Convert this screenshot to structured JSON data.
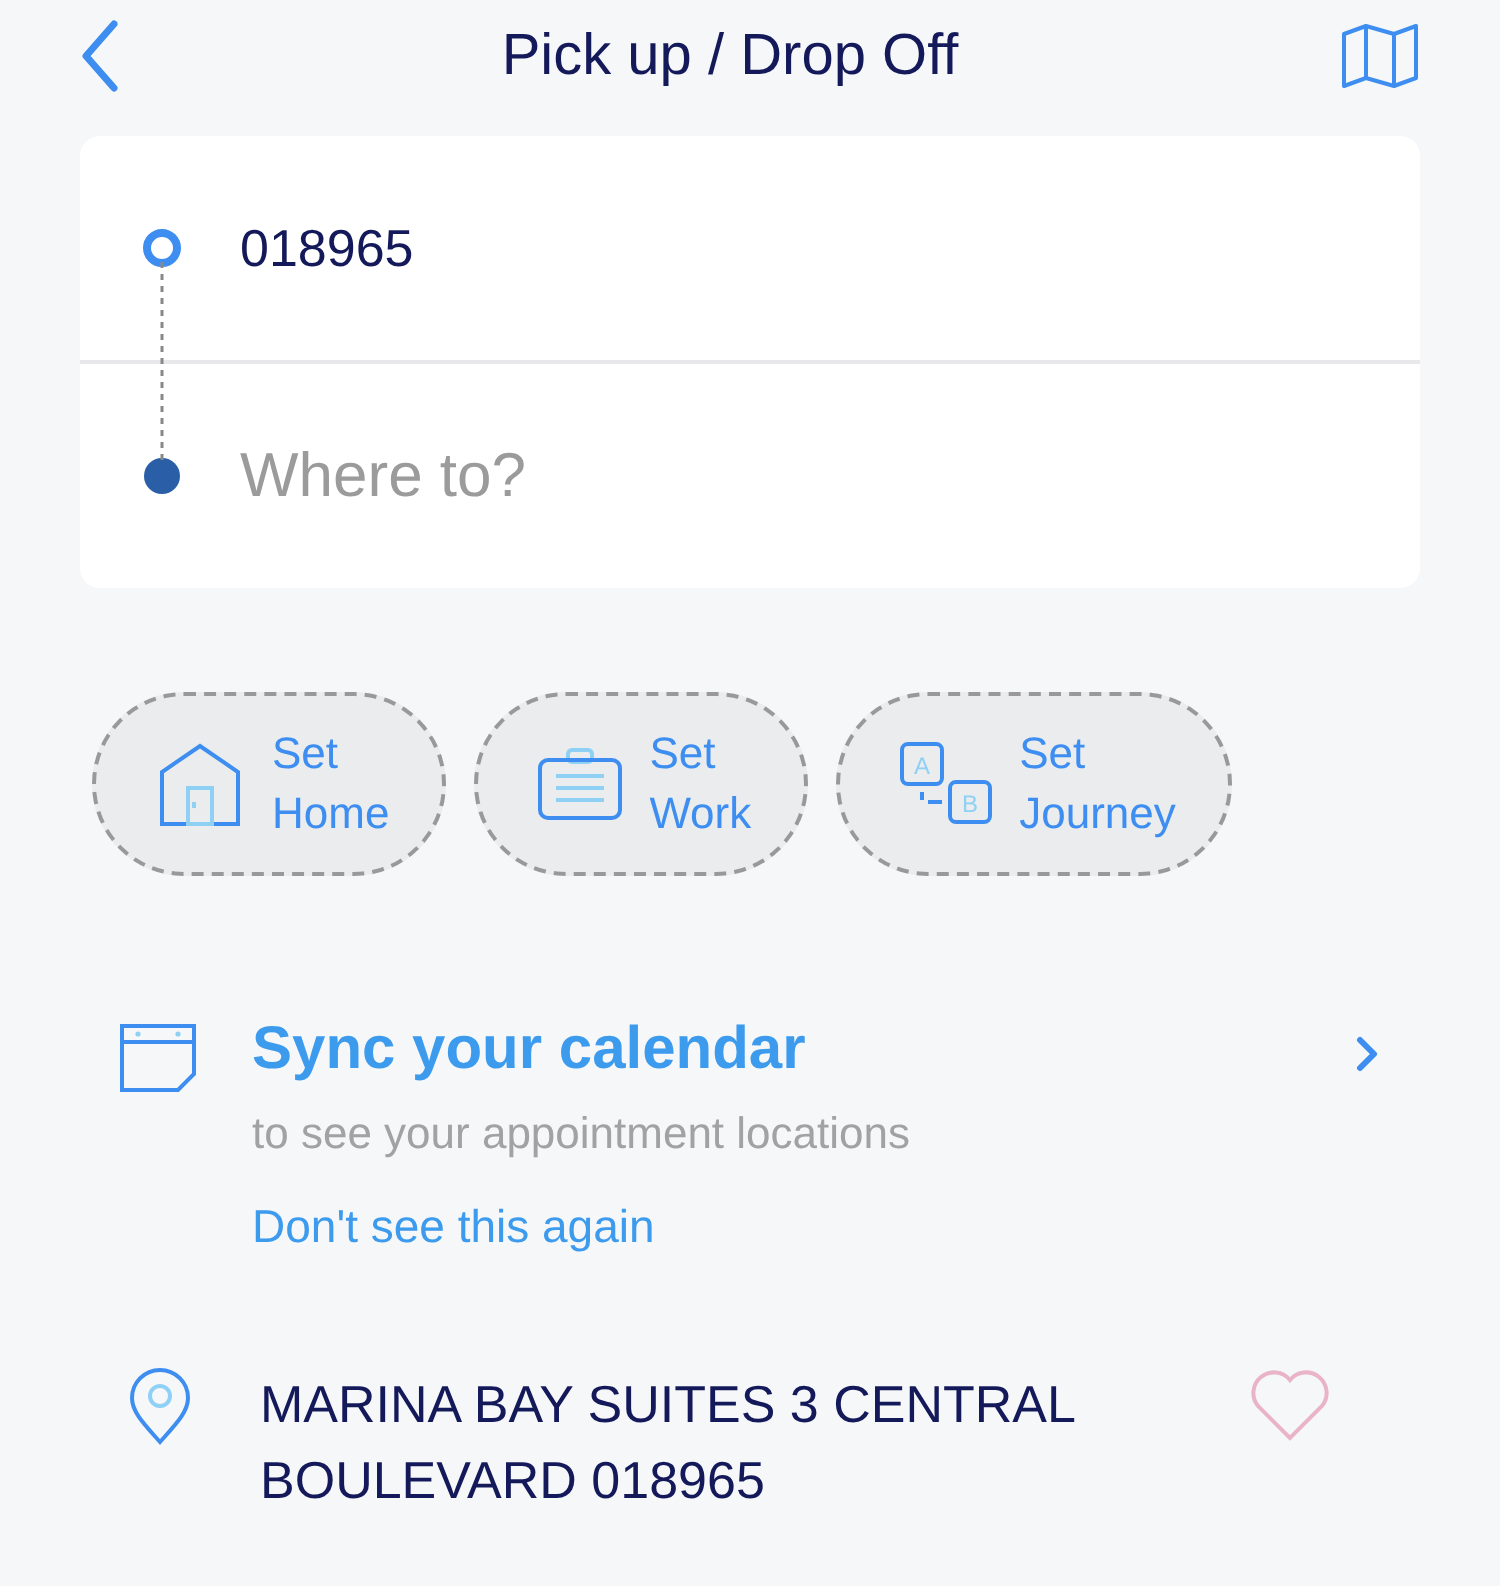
{
  "header": {
    "title": "Pick up / Drop Off"
  },
  "route": {
    "pickup": {
      "value": "018965"
    },
    "dropoff": {
      "placeholder": "Where to?"
    }
  },
  "shortcuts": [
    {
      "kind": "home",
      "line1": "Set",
      "line2": "Home"
    },
    {
      "kind": "work",
      "line1": "Set",
      "line2": "Work"
    },
    {
      "kind": "journey",
      "line1": "Set",
      "line2": "Journey",
      "icon_letters": [
        "A",
        "B"
      ]
    }
  ],
  "calendar_prompt": {
    "title": "Sync your calendar",
    "subtitle": "to see your appointment locations",
    "dismiss": "Don't see this again"
  },
  "places": [
    {
      "address": "MARINA BAY SUITES 3 CENTRAL BOULEVARD 018965",
      "favorite": false
    }
  ]
}
